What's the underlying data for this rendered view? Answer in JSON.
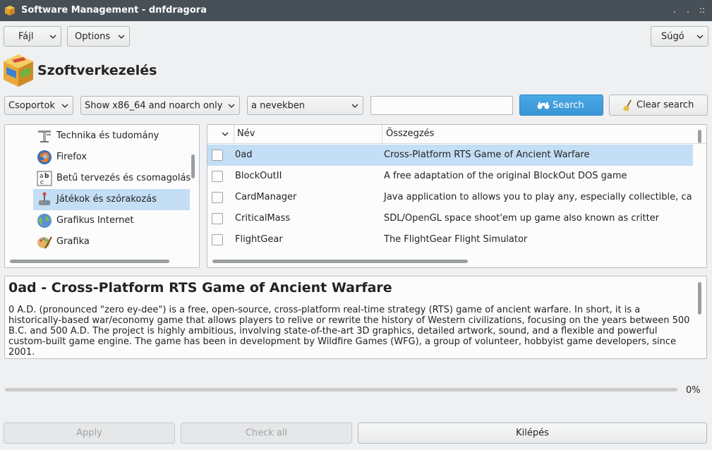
{
  "window": {
    "title": "Software Management - dnfdragora",
    "controls": {
      "minimize": ".",
      "maximize": ".",
      "close": "::"
    }
  },
  "menubar": {
    "file": "Fájl",
    "options": "Options",
    "help": "Súgó"
  },
  "header": {
    "title": "Szoftverkezelés"
  },
  "toolbar": {
    "view_select": "Csoportok",
    "arch_filter": "Show x86_64 and noarch only",
    "search_in": "a nevekben",
    "search_value": "",
    "search_button": "Search",
    "clear_button": "Clear search"
  },
  "groups": [
    {
      "label": "Technika és tudomány",
      "icon": "science-icon"
    },
    {
      "label": "Firefox",
      "icon": "firefox-icon"
    },
    {
      "label": "Betű tervezés és csomagolás",
      "icon": "font-icon"
    },
    {
      "label": "Játékok és szórakozás",
      "icon": "games-icon",
      "selected": true
    },
    {
      "label": "Grafikus Internet",
      "icon": "internet-icon"
    },
    {
      "label": "Grafika",
      "icon": "graphics-icon"
    }
  ],
  "packages": {
    "columns": {
      "name": "Név",
      "summary": "Összegzés"
    },
    "rows": [
      {
        "name": "0ad",
        "summary": "Cross-Platform RTS Game of Ancient Warfare",
        "selected": true
      },
      {
        "name": "BlockOutII",
        "summary": "A free adaptation of the original BlockOut DOS game"
      },
      {
        "name": "CardManager",
        "summary": "Java application to allows you to play any, especially collectible, ca"
      },
      {
        "name": "CriticalMass",
        "summary": "SDL/OpenGL space shoot'em up game also known as critter"
      },
      {
        "name": "FlightGear",
        "summary": "The FlightGear Flight Simulator"
      }
    ]
  },
  "description": {
    "title": "0ad - Cross-Platform RTS Game of Ancient Warfare",
    "body": "0 A.D. (pronounced \"zero ey-dee\") is a free, open-source, cross-platform real-time strategy (RTS) game of ancient warfare. In short, it is a historically-based war/economy game that allows players to relive or rewrite the history of Western civilizations, focusing on the years between 500 B.C. and 500 A.D. The project is highly ambitious, involving state-of-the-art 3D graphics, detailed artwork, sound, and a flexible and powerful custom-built game engine. The game has been in development by Wildfire Games (WFG), a group of volunteer, hobbyist game developers, since 2001."
  },
  "progress": {
    "value": 0,
    "label": "0%"
  },
  "footer": {
    "apply": "Apply",
    "check_all": "Check all",
    "quit": "Kilépés"
  },
  "colors": {
    "accent": "#3a96d6",
    "selection": "#c3def5",
    "titlebar": "#475057"
  }
}
